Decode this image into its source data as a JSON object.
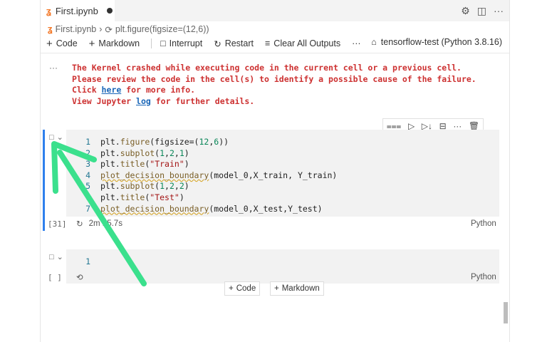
{
  "tab": {
    "icon": "jupyter-icon",
    "title": "First.ipynb"
  },
  "tab_actions": {
    "settings": "gear-icon",
    "split": "split-editor-icon",
    "more": "ellipsis-icon"
  },
  "breadcrumb": {
    "file": "First.ipynb",
    "symbol": "plt.figure(figsize=(12,6))"
  },
  "toolbar": {
    "code": "Code",
    "markdown": "Markdown",
    "interrupt": "Interrupt",
    "restart": "Restart",
    "clear_outputs": "Clear All Outputs",
    "more": "···",
    "kernel": "tensorflow-test (Python 3.8.16)"
  },
  "error": {
    "line1": "The Kernel crashed while executing code in the current cell or a previous cell.",
    "line2": "Please review the code in the cell(s) to identify a possible cause of the failure.",
    "line3_pre": "Click ",
    "line3_link": "here",
    "line3_post": " for more info.",
    "line4_pre": "View Jupyter ",
    "line4_link": "log",
    "line4_post": " for further details.",
    "gutter": "···"
  },
  "cell1": {
    "execution_count": "[31]",
    "elapsed": "2m 15.7s",
    "language": "Python",
    "line_numbers": [
      "1",
      "2",
      "3",
      "4",
      "5",
      "6",
      "7"
    ]
  },
  "cell2": {
    "execution_count": "[ ]",
    "language": "Python",
    "line_number": "1"
  },
  "add_cell": {
    "code": "Code",
    "markdown": "Markdown"
  },
  "colors": {
    "error": "#cd3131",
    "focus": "#2f80ed",
    "arrow": "#3be08d"
  }
}
